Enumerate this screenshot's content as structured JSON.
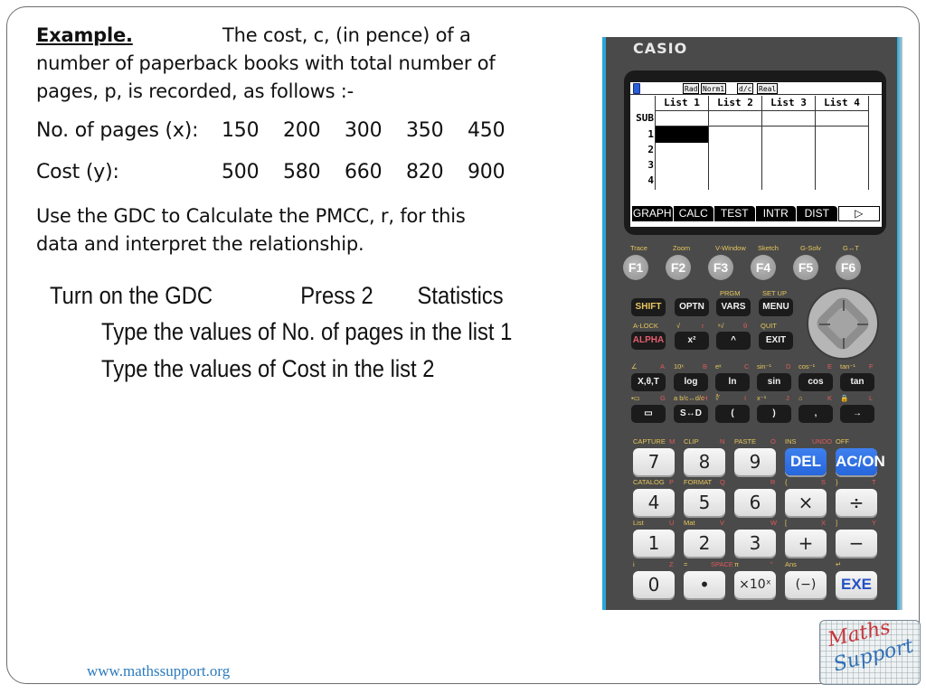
{
  "slide": {
    "example_heading": "Example.",
    "intro_line1": "The cost, c, (in pence) of a",
    "intro_line2": "number of paperback books with total number of",
    "intro_line3": "pages, p, is recorded, as follows :-",
    "table": {
      "x_label": "No. of pages (x):",
      "x_values": [
        "150",
        "200",
        "300",
        "350",
        "450"
      ],
      "y_label": "Cost (y):",
      "y_values": [
        "500",
        "580",
        "660",
        "820",
        "900"
      ]
    },
    "question_line1": "Use the GDC to Calculate the PMCC, r, for this",
    "question_line2": "data and interpret the relationship.",
    "steps": {
      "step1": "Turn on the GDC",
      "step2": "Press 2",
      "step3": "Statistics",
      "step4": "Type the values of No. of pages in the list 1",
      "step5": "Type the values of Cost in the list 2"
    },
    "footer_url": "www.mathssupport.org",
    "logo": {
      "line1": "Maths",
      "line2": "Support"
    }
  },
  "calculator": {
    "brand": "CASIO",
    "screen": {
      "badges": [
        "Rad",
        "Norm1",
        "d/c",
        "Real"
      ],
      "columns": [
        "List 1",
        "List 2",
        "List 3",
        "List 4"
      ],
      "rows": [
        "SUB",
        "1",
        "2",
        "3",
        "4"
      ],
      "function_tabs": [
        "GRAPH",
        "CALC",
        "TEST",
        "INTR",
        "DIST",
        "▷"
      ]
    },
    "f_keys": [
      {
        "label": "F1",
        "above": "Trace"
      },
      {
        "label": "F2",
        "above": "Zoom"
      },
      {
        "label": "F3",
        "above": "V-Window"
      },
      {
        "label": "F4",
        "above": "Sketch"
      },
      {
        "label": "F5",
        "above": "G-Solv"
      },
      {
        "label": "F6",
        "above": "G↔T"
      }
    ],
    "row1": [
      {
        "label": "SHIFT",
        "above": ""
      },
      {
        "label": "OPTN",
        "above": ""
      },
      {
        "label": "VARS",
        "above": "PRGM"
      },
      {
        "label": "MENU",
        "above": "SET UP"
      }
    ],
    "row2": [
      {
        "label": "ALPHA",
        "above": "A-LOCK"
      },
      {
        "label": "x²",
        "above": "√",
        "above_red": "r"
      },
      {
        "label": "^",
        "above": "ˣ√",
        "above_red": "θ"
      },
      {
        "label": "EXIT",
        "above": "QUIT"
      }
    ],
    "row3": [
      {
        "label": "X,θ,T",
        "above": "∠",
        "above_red": "A"
      },
      {
        "label": "log",
        "above": "10ˣ",
        "above_red": "B"
      },
      {
        "label": "ln",
        "above": "eˣ",
        "above_red": "C"
      },
      {
        "label": "sin",
        "above": "sin⁻¹",
        "above_red": "D"
      },
      {
        "label": "cos",
        "above": "cos⁻¹",
        "above_red": "E"
      },
      {
        "label": "tan",
        "above": "tan⁻¹",
        "above_red": "F"
      }
    ],
    "row4": [
      {
        "label": "▭",
        "above": "▪▭",
        "above_red": "G"
      },
      {
        "label": "S↔D",
        "above": "a b/c↔d/c",
        "above_red": "H"
      },
      {
        "label": "(",
        "above": "∛",
        "above_red": "I"
      },
      {
        "label": ")",
        "above": "x⁻¹",
        "above_red": "J"
      },
      {
        "label": ",",
        "above": "⌂",
        "above_red": "K"
      },
      {
        "label": "→",
        "above": "🔒",
        "above_red": "L"
      }
    ],
    "num_row1": [
      {
        "label": "7",
        "above": "CAPTURE",
        "above_red": "M"
      },
      {
        "label": "8",
        "above": "CLIP",
        "above_red": "N"
      },
      {
        "label": "9",
        "above": "PASTE",
        "above_red": "O"
      },
      {
        "label": "DEL",
        "above": "INS",
        "above_red": "UNDO"
      },
      {
        "label": "AC/ON",
        "above": "OFF",
        "above_red": ""
      }
    ],
    "num_row2": [
      {
        "label": "4",
        "above": "CATALOG",
        "above_red": "P"
      },
      {
        "label": "5",
        "above": "FORMAT",
        "above_red": "Q"
      },
      {
        "label": "6",
        "above": "",
        "above_red": "R"
      },
      {
        "label": "×",
        "above": "{",
        "above_red": "S"
      },
      {
        "label": "÷",
        "above": "}",
        "above_red": "T"
      }
    ],
    "num_row3": [
      {
        "label": "1",
        "above": "List",
        "above_red": "U"
      },
      {
        "label": "2",
        "above": "Mat",
        "above_red": "V"
      },
      {
        "label": "3",
        "above": "",
        "above_red": "W"
      },
      {
        "label": "+",
        "above": "[",
        "above_red": "X"
      },
      {
        "label": "−",
        "above": "]",
        "above_red": "Y"
      }
    ],
    "num_row4": [
      {
        "label": "0",
        "above": "i",
        "above_red": "Z"
      },
      {
        "label": "•",
        "above": "=",
        "above_red": "SPACE"
      },
      {
        "label": "×10ˣ",
        "above": "π",
        "above_red": "\""
      },
      {
        "label": "(−)",
        "above": "Ans",
        "above_red": ""
      },
      {
        "label": "EXE",
        "above": "↵",
        "above_red": ""
      }
    ]
  }
}
